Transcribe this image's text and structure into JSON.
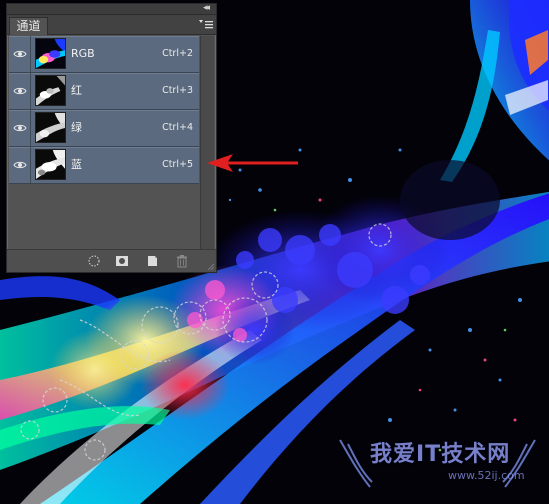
{
  "panel": {
    "collapse_glyph": "◂◂",
    "tab_label": "通道",
    "menu_icon": "panel-menu-icon",
    "channels": [
      {
        "name": "RGB",
        "shortcut": "Ctrl+2",
        "visible": true
      },
      {
        "name": "红",
        "shortcut": "Ctrl+3",
        "visible": true
      },
      {
        "name": "绿",
        "shortcut": "Ctrl+4",
        "visible": true
      },
      {
        "name": "蓝",
        "shortcut": "Ctrl+5",
        "visible": true
      }
    ],
    "footer_icons": [
      "load-selection-icon",
      "save-selection-icon",
      "new-channel-icon",
      "delete-channel-icon"
    ]
  },
  "annotation": {
    "color": "#e02020"
  },
  "watermark": {
    "brand": "我爱IT技术网",
    "url": "www.52ij.com"
  },
  "colors": {
    "row_bg": "#5b6a7e",
    "panel_bg": "#535353"
  }
}
